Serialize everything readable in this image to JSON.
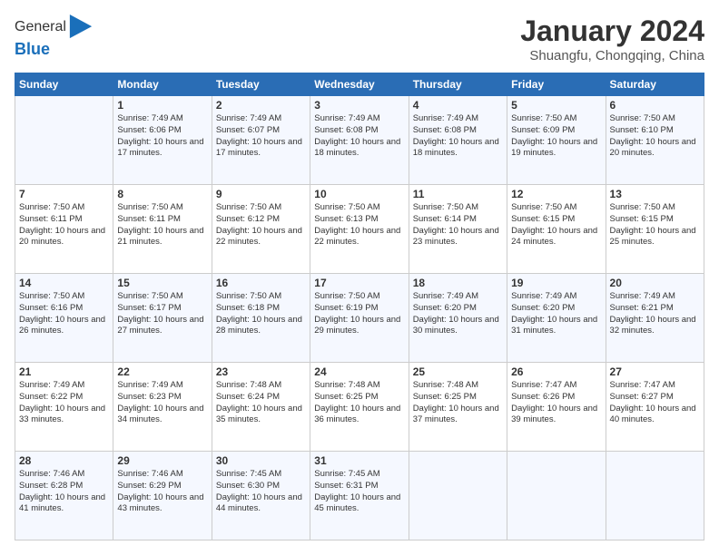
{
  "header": {
    "logo_line1": "General",
    "logo_line2": "Blue",
    "month_year": "January 2024",
    "location": "Shuangfu, Chongqing, China"
  },
  "days_of_week": [
    "Sunday",
    "Monday",
    "Tuesday",
    "Wednesday",
    "Thursday",
    "Friday",
    "Saturday"
  ],
  "weeks": [
    [
      {
        "day": "",
        "sunrise": "",
        "sunset": "",
        "daylight": ""
      },
      {
        "day": "1",
        "sunrise": "Sunrise: 7:49 AM",
        "sunset": "Sunset: 6:06 PM",
        "daylight": "Daylight: 10 hours and 17 minutes."
      },
      {
        "day": "2",
        "sunrise": "Sunrise: 7:49 AM",
        "sunset": "Sunset: 6:07 PM",
        "daylight": "Daylight: 10 hours and 17 minutes."
      },
      {
        "day": "3",
        "sunrise": "Sunrise: 7:49 AM",
        "sunset": "Sunset: 6:08 PM",
        "daylight": "Daylight: 10 hours and 18 minutes."
      },
      {
        "day": "4",
        "sunrise": "Sunrise: 7:49 AM",
        "sunset": "Sunset: 6:08 PM",
        "daylight": "Daylight: 10 hours and 18 minutes."
      },
      {
        "day": "5",
        "sunrise": "Sunrise: 7:50 AM",
        "sunset": "Sunset: 6:09 PM",
        "daylight": "Daylight: 10 hours and 19 minutes."
      },
      {
        "day": "6",
        "sunrise": "Sunrise: 7:50 AM",
        "sunset": "Sunset: 6:10 PM",
        "daylight": "Daylight: 10 hours and 20 minutes."
      }
    ],
    [
      {
        "day": "7",
        "sunrise": "Sunrise: 7:50 AM",
        "sunset": "Sunset: 6:11 PM",
        "daylight": "Daylight: 10 hours and 20 minutes."
      },
      {
        "day": "8",
        "sunrise": "Sunrise: 7:50 AM",
        "sunset": "Sunset: 6:11 PM",
        "daylight": "Daylight: 10 hours and 21 minutes."
      },
      {
        "day": "9",
        "sunrise": "Sunrise: 7:50 AM",
        "sunset": "Sunset: 6:12 PM",
        "daylight": "Daylight: 10 hours and 22 minutes."
      },
      {
        "day": "10",
        "sunrise": "Sunrise: 7:50 AM",
        "sunset": "Sunset: 6:13 PM",
        "daylight": "Daylight: 10 hours and 22 minutes."
      },
      {
        "day": "11",
        "sunrise": "Sunrise: 7:50 AM",
        "sunset": "Sunset: 6:14 PM",
        "daylight": "Daylight: 10 hours and 23 minutes."
      },
      {
        "day": "12",
        "sunrise": "Sunrise: 7:50 AM",
        "sunset": "Sunset: 6:15 PM",
        "daylight": "Daylight: 10 hours and 24 minutes."
      },
      {
        "day": "13",
        "sunrise": "Sunrise: 7:50 AM",
        "sunset": "Sunset: 6:15 PM",
        "daylight": "Daylight: 10 hours and 25 minutes."
      }
    ],
    [
      {
        "day": "14",
        "sunrise": "Sunrise: 7:50 AM",
        "sunset": "Sunset: 6:16 PM",
        "daylight": "Daylight: 10 hours and 26 minutes."
      },
      {
        "day": "15",
        "sunrise": "Sunrise: 7:50 AM",
        "sunset": "Sunset: 6:17 PM",
        "daylight": "Daylight: 10 hours and 27 minutes."
      },
      {
        "day": "16",
        "sunrise": "Sunrise: 7:50 AM",
        "sunset": "Sunset: 6:18 PM",
        "daylight": "Daylight: 10 hours and 28 minutes."
      },
      {
        "day": "17",
        "sunrise": "Sunrise: 7:50 AM",
        "sunset": "Sunset: 6:19 PM",
        "daylight": "Daylight: 10 hours and 29 minutes."
      },
      {
        "day": "18",
        "sunrise": "Sunrise: 7:49 AM",
        "sunset": "Sunset: 6:20 PM",
        "daylight": "Daylight: 10 hours and 30 minutes."
      },
      {
        "day": "19",
        "sunrise": "Sunrise: 7:49 AM",
        "sunset": "Sunset: 6:20 PM",
        "daylight": "Daylight: 10 hours and 31 minutes."
      },
      {
        "day": "20",
        "sunrise": "Sunrise: 7:49 AM",
        "sunset": "Sunset: 6:21 PM",
        "daylight": "Daylight: 10 hours and 32 minutes."
      }
    ],
    [
      {
        "day": "21",
        "sunrise": "Sunrise: 7:49 AM",
        "sunset": "Sunset: 6:22 PM",
        "daylight": "Daylight: 10 hours and 33 minutes."
      },
      {
        "day": "22",
        "sunrise": "Sunrise: 7:49 AM",
        "sunset": "Sunset: 6:23 PM",
        "daylight": "Daylight: 10 hours and 34 minutes."
      },
      {
        "day": "23",
        "sunrise": "Sunrise: 7:48 AM",
        "sunset": "Sunset: 6:24 PM",
        "daylight": "Daylight: 10 hours and 35 minutes."
      },
      {
        "day": "24",
        "sunrise": "Sunrise: 7:48 AM",
        "sunset": "Sunset: 6:25 PM",
        "daylight": "Daylight: 10 hours and 36 minutes."
      },
      {
        "day": "25",
        "sunrise": "Sunrise: 7:48 AM",
        "sunset": "Sunset: 6:25 PM",
        "daylight": "Daylight: 10 hours and 37 minutes."
      },
      {
        "day": "26",
        "sunrise": "Sunrise: 7:47 AM",
        "sunset": "Sunset: 6:26 PM",
        "daylight": "Daylight: 10 hours and 39 minutes."
      },
      {
        "day": "27",
        "sunrise": "Sunrise: 7:47 AM",
        "sunset": "Sunset: 6:27 PM",
        "daylight": "Daylight: 10 hours and 40 minutes."
      }
    ],
    [
      {
        "day": "28",
        "sunrise": "Sunrise: 7:46 AM",
        "sunset": "Sunset: 6:28 PM",
        "daylight": "Daylight: 10 hours and 41 minutes."
      },
      {
        "day": "29",
        "sunrise": "Sunrise: 7:46 AM",
        "sunset": "Sunset: 6:29 PM",
        "daylight": "Daylight: 10 hours and 43 minutes."
      },
      {
        "day": "30",
        "sunrise": "Sunrise: 7:45 AM",
        "sunset": "Sunset: 6:30 PM",
        "daylight": "Daylight: 10 hours and 44 minutes."
      },
      {
        "day": "31",
        "sunrise": "Sunrise: 7:45 AM",
        "sunset": "Sunset: 6:31 PM",
        "daylight": "Daylight: 10 hours and 45 minutes."
      },
      {
        "day": "",
        "sunrise": "",
        "sunset": "",
        "daylight": ""
      },
      {
        "day": "",
        "sunrise": "",
        "sunset": "",
        "daylight": ""
      },
      {
        "day": "",
        "sunrise": "",
        "sunset": "",
        "daylight": ""
      }
    ]
  ]
}
